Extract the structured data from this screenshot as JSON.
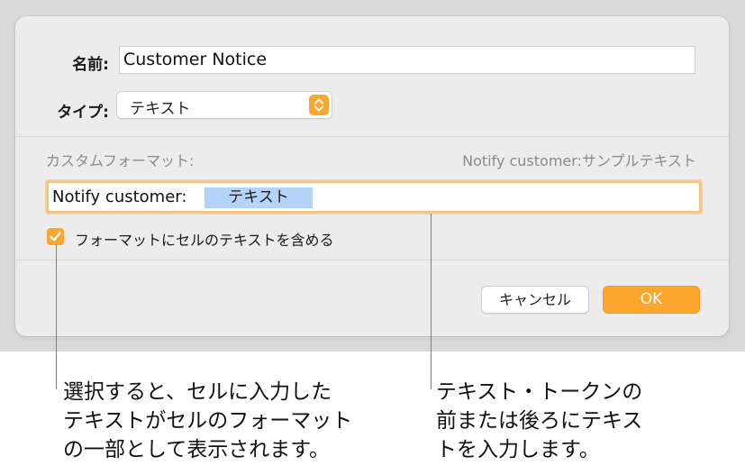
{
  "dialog": {
    "name_label": "名前:",
    "name_value": "Customer Notice",
    "type_label": "タイプ:",
    "type_value": "テキスト",
    "custom_format_label": "カスタムフォーマット:",
    "sample_text": "Notify customer:サンプルテキスト",
    "format_prefix": "Notify customer:",
    "format_token": "テキスト",
    "checkbox_label": "フォーマットにセルのテキストを含める",
    "checkbox_checked": true,
    "cancel_label": "キャンセル",
    "ok_label": "OK"
  },
  "callouts": {
    "left": [
      "選択すると、セルに入力した",
      "テキストがセルのフォーマット",
      "の一部として表示されます。"
    ],
    "right": [
      "テキスト・トークンの",
      "前または後ろにテキス",
      "トを入力します。"
    ]
  },
  "colors": {
    "accent": "#fda62e",
    "token_bg": "#b4d3f8",
    "dialog_bg": "#ececec"
  },
  "icons": {
    "stepper": "up-down-chevron-icon",
    "checkbox": "checkmark-icon"
  }
}
